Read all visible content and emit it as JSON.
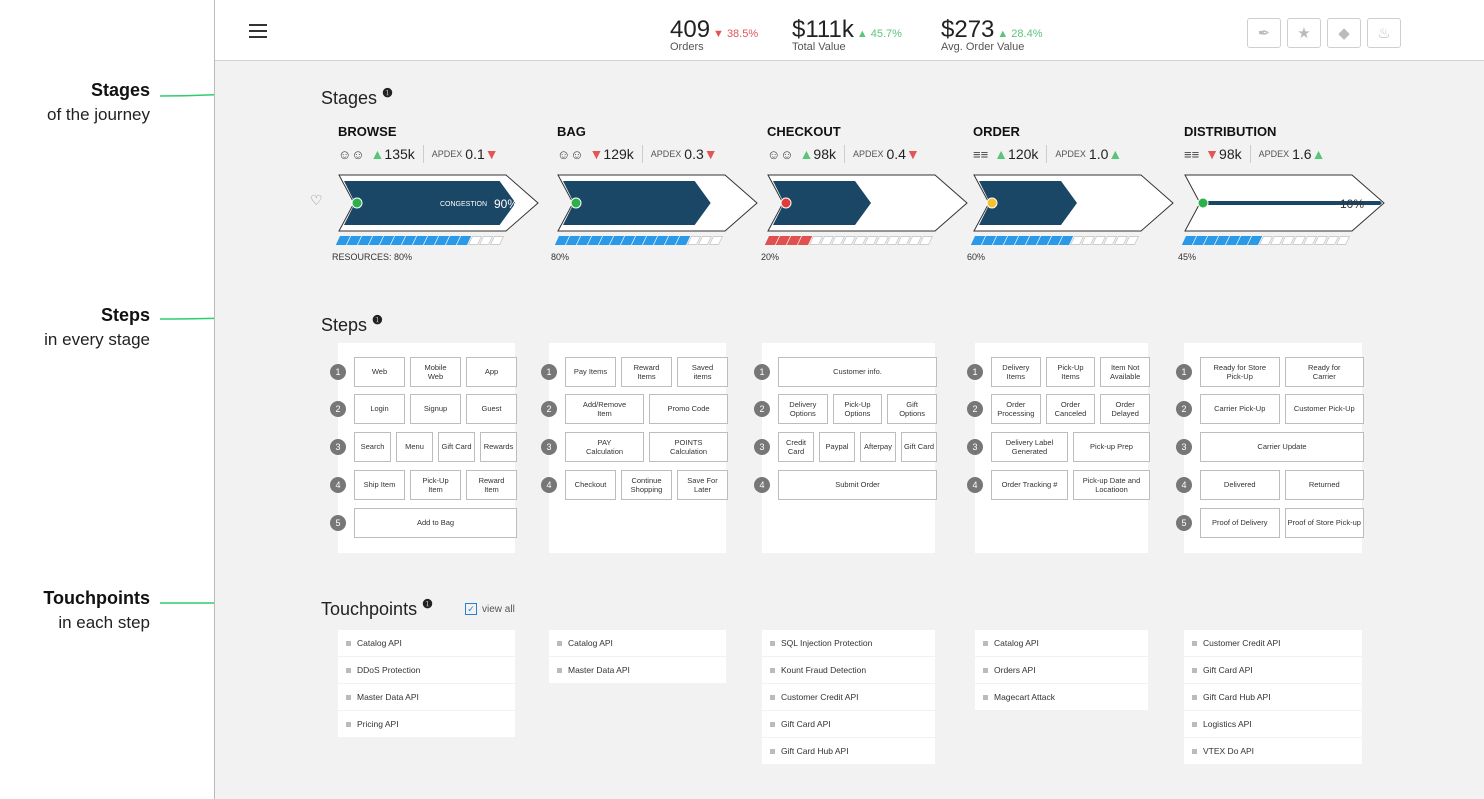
{
  "annotations": [
    {
      "title": "Stages",
      "sub": "of the journey"
    },
    {
      "title": "Steps",
      "sub": "in every stage"
    },
    {
      "title": "Touchpoints",
      "sub": "in each step"
    }
  ],
  "header": {
    "metrics": [
      {
        "value": "409",
        "dir": "down",
        "delta": "38.5%",
        "label": "Orders"
      },
      {
        "value": "$111k",
        "dir": "up",
        "delta": "45.7%",
        "label": "Total Value"
      },
      {
        "value": "$273",
        "dir": "up",
        "delta": "28.4%",
        "label": "Avg. Order Value"
      }
    ],
    "icons": [
      "feather-icon",
      "star-icon",
      "drop-icon",
      "flame-icon"
    ]
  },
  "sections": {
    "stages": "Stages",
    "steps": "Steps",
    "touchpoints": "Touchpoints",
    "view_all": "view all"
  },
  "stages": [
    {
      "name": "BROWSE",
      "icon": "users-icon",
      "count_dir": "up",
      "count": "135k",
      "apdex_label": "APDEX",
      "apdex": "0.1",
      "apdex_dir": "down",
      "status_color": "#2bb04a",
      "fill": 0.9,
      "percent": "90%",
      "sub_label": "CONGESTION",
      "resources": "RESOURCES: 80%",
      "bar_on": 12,
      "bar_color": "blue"
    },
    {
      "name": "BAG",
      "icon": "users-icon",
      "count_dir": "down",
      "count": "129k",
      "apdex_label": "APDEX",
      "apdex": "0.3",
      "apdex_dir": "down",
      "status_color": "#2bb04a",
      "fill": 0.77,
      "percent": "77%",
      "sub_label": "",
      "resources": "80%",
      "bar_on": 12,
      "bar_color": "blue"
    },
    {
      "name": "CHECKOUT",
      "icon": "users-icon",
      "count_dir": "up",
      "count": "98k",
      "apdex_label": "APDEX",
      "apdex": "0.4",
      "apdex_dir": "down",
      "status_color": "#e23b3b",
      "fill": 0.5,
      "percent": "50%",
      "sub_label": "",
      "resources": "20%",
      "bar_on": 4,
      "bar_color": "red"
    },
    {
      "name": "ORDER",
      "icon": "servers-icon",
      "count_dir": "up",
      "count": "120k",
      "apdex_label": "APDEX",
      "apdex": "1.0",
      "apdex_dir": "up",
      "status_color": "#f2c230",
      "fill": 0.5,
      "percent": "50%",
      "sub_label": "",
      "resources": "60%",
      "bar_on": 9,
      "bar_color": "blue"
    },
    {
      "name": "DISTRIBUTION",
      "icon": "servers-icon",
      "count_dir": "down",
      "count": "98k",
      "apdex_label": "APDEX",
      "apdex": "1.6",
      "apdex_dir": "up",
      "status_color": "#2bb04a",
      "fill": 0.1,
      "percent": "10%",
      "sub_label": "",
      "resources": "45%",
      "bar_on": 7,
      "bar_color": "blue"
    }
  ],
  "steps": [
    {
      "rows": [
        [
          "Web",
          "Mobile\nWeb",
          "App"
        ],
        [
          "Login",
          "Signup",
          "Guest"
        ],
        [
          "Search",
          "Menu",
          "Gift Card",
          "Rewards"
        ],
        [
          "Ship Item",
          "Pick-Up\nItem",
          "Reward\nItem"
        ],
        [
          "Add to Bag"
        ]
      ]
    },
    {
      "rows": [
        [
          "Pay Items",
          "Reward\nItems",
          "Saved\nitems"
        ],
        [
          "Add/Remove\nItem",
          "Promo Code"
        ],
        [
          "PAY\nCalculation",
          "POINTS\nCalculation"
        ],
        [
          "Checkout",
          "Continue\nShopping",
          "Save For\nLater"
        ]
      ]
    },
    {
      "rows": [
        [
          "Customer info."
        ],
        [
          "Delivery\nOptions",
          "Pick-Up\nOptions",
          "Gift\nOptions"
        ],
        [
          "Credit\nCard",
          "Paypal",
          "Afterpay",
          "Gift Card"
        ],
        [
          "Submit Order"
        ]
      ]
    },
    {
      "rows": [
        [
          "Delivery\nItems",
          "Pick-Up\nItems",
          "Item Not\nAvailable"
        ],
        [
          "Order\nProcessing",
          "Order\nCanceled",
          "Order\nDelayed"
        ],
        [
          "Delivery Label\nGenerated",
          "Pick-up Prep"
        ],
        [
          "Order Tracking #",
          "Pick-up Date and\nLocatioon"
        ]
      ]
    },
    {
      "rows": [
        [
          "Ready for Store\nPick-Up",
          "Ready for\nCarrier"
        ],
        [
          "Carrier Pick-Up",
          "Customer Pick-Up"
        ],
        [
          "Carrier Update"
        ],
        [
          "Delivered",
          "Returned"
        ],
        [
          "Proof of Delivery",
          "Proof of Store Pick-up"
        ]
      ]
    }
  ],
  "touchpoints": [
    [
      "Catalog API",
      "DDoS Protection",
      "Master Data API",
      "Pricing API"
    ],
    [
      "Catalog API",
      "Master Data API"
    ],
    [
      "SQL Injection Protection",
      "Kount Fraud Detection",
      "Customer Credit API",
      "Gift Card API",
      "Gift Card Hub API"
    ],
    [
      "Catalog API",
      "Orders API",
      "Magecart Attack"
    ],
    [
      "Customer Credit API",
      "Gift Card API",
      "Gift Card Hub API",
      "Logistics API",
      "VTEX Do API"
    ]
  ]
}
